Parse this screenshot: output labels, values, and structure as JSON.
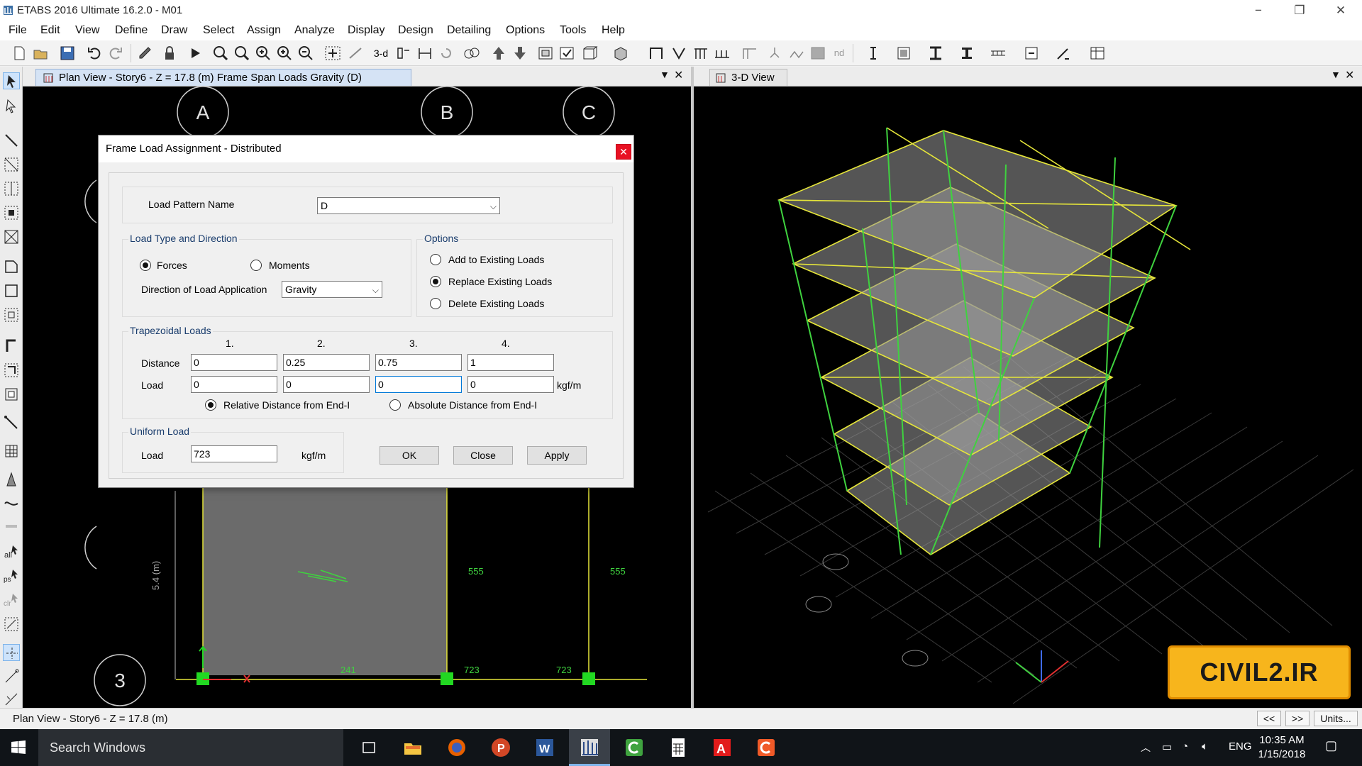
{
  "window": {
    "title": "ETABS 2016 Ultimate 16.2.0 - M01",
    "min": "−",
    "restore": "❐",
    "close": "✕"
  },
  "menu": [
    "File",
    "Edit",
    "View",
    "Define",
    "Draw",
    "Select",
    "Assign",
    "Analyze",
    "Display",
    "Design",
    "Detailing",
    "Options",
    "Tools",
    "Help"
  ],
  "toolbar": {
    "label_3d": "3-d",
    "label_nd": "nd"
  },
  "plan": {
    "tab_title": "Plan View - Story6 - Z = 17.8 (m)  Frame Span Loads Gravity (D)",
    "grid_a": "A",
    "grid_b": "B",
    "grid_c": "C",
    "grid_3": "3",
    "dim_label": "5.4 (m)",
    "load_555_a": "555",
    "load_555_b": "555",
    "load_241": "241",
    "load_723_a": "723",
    "load_723_b": "723"
  },
  "view3d": {
    "tab_title": "3-D View"
  },
  "dialog": {
    "title": "Frame Load Assignment - Distributed",
    "close": "✕",
    "load_pattern_label": "Load Pattern Name",
    "load_pattern_value": "D",
    "load_type_group": "Load Type and Direction",
    "forces": "Forces",
    "moments": "Moments",
    "direction_label": "Direction of Load Application",
    "direction_value": "Gravity",
    "options_group": "Options",
    "opt_add": "Add to Existing Loads",
    "opt_replace": "Replace Existing Loads",
    "opt_delete": "Delete Existing Loads",
    "trap_group": "Trapezoidal Loads",
    "col_headers": [
      "1.",
      "2.",
      "3.",
      "4."
    ],
    "distance_label": "Distance",
    "load_label": "Load",
    "distances": [
      "0",
      "0.25",
      "0.75",
      "1"
    ],
    "loads": [
      "0",
      "0",
      "0",
      "0"
    ],
    "unit": "kgf/m",
    "relative": "Relative Distance from End-I",
    "absolute": "Absolute Distance from End-I",
    "uniform_group": "Uniform Load",
    "uniform_label": "Load",
    "uniform_value": "723",
    "uniform_unit": "kgf/m",
    "ok": "OK",
    "close_btn": "Close",
    "apply": "Apply"
  },
  "status": {
    "text": "Plan View - Story6 - Z = 17.8 (m)",
    "prev": "<<",
    "next": ">>",
    "units": "Units..."
  },
  "taskbar": {
    "search": "Search Windows",
    "lang": "ENG",
    "time": "10:35 AM",
    "date": "1/15/2018"
  },
  "watermark": "CIVIL2.IR",
  "colors": {
    "frame_green": "#3fd23f",
    "frame_yellow": "#e6e63a",
    "plan_slab": "#6b6b6b",
    "accent": "#0078d7"
  }
}
